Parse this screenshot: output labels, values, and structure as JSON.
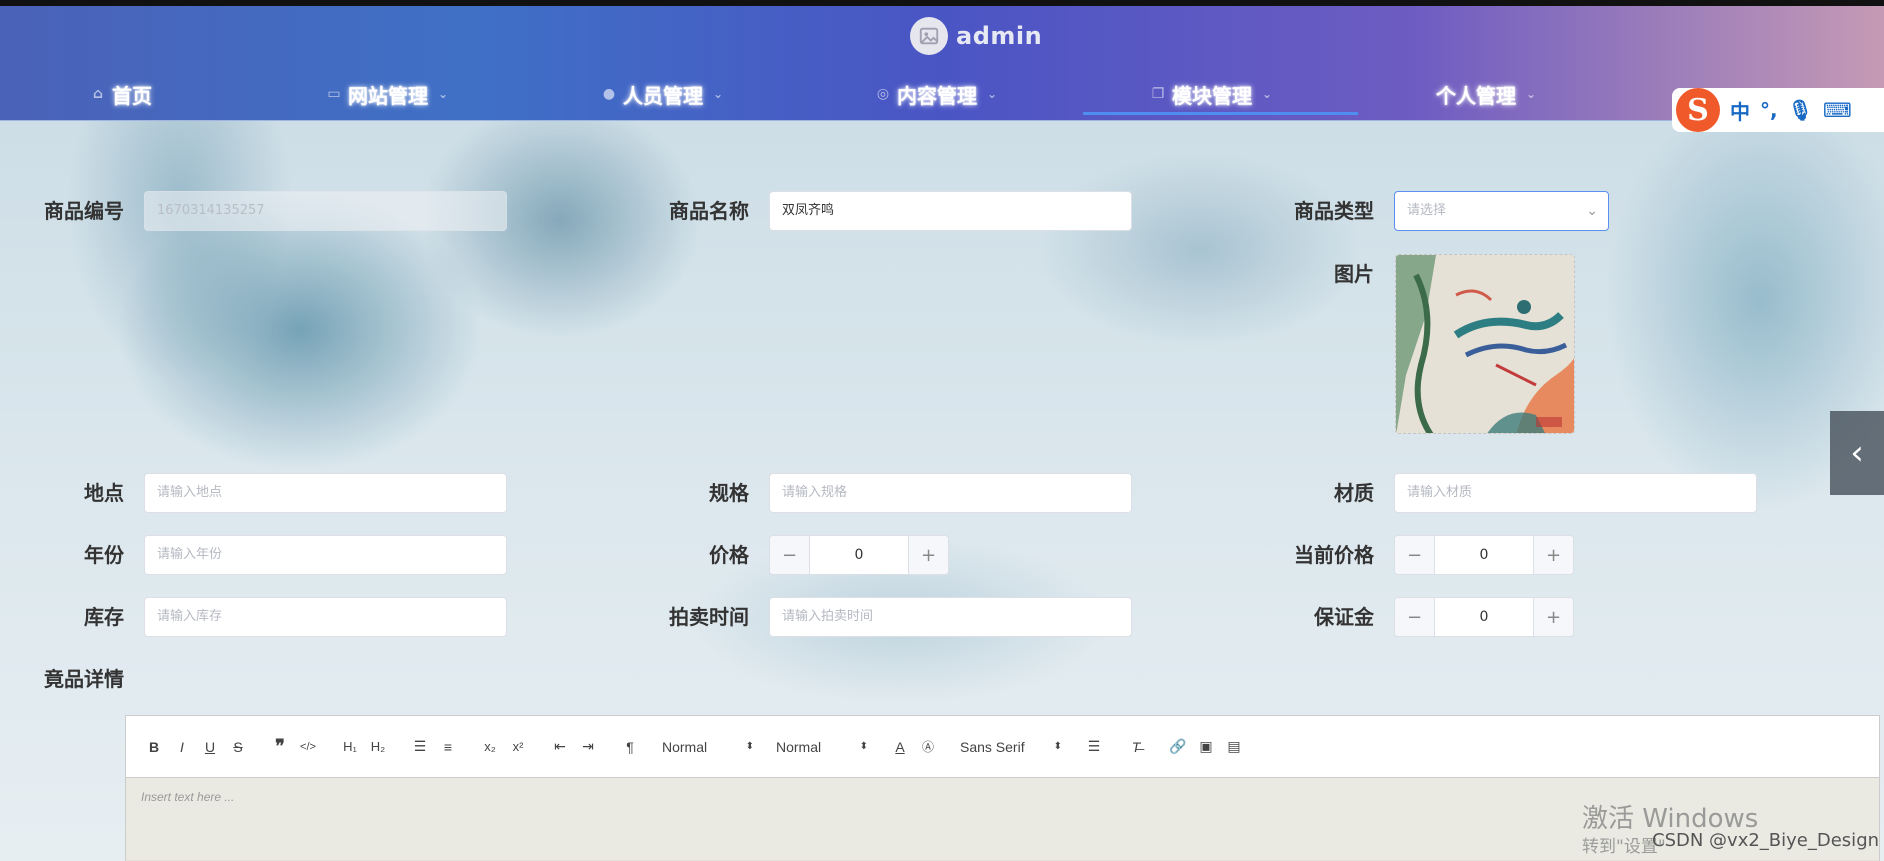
{
  "header": {
    "username": "admin",
    "nav": [
      {
        "label": "首页",
        "icon": "home-icon"
      },
      {
        "label": "网站管理",
        "icon": "monitor-icon"
      },
      {
        "label": "人员管理",
        "icon": "user-icon"
      },
      {
        "label": "内容管理",
        "icon": "content-icon"
      },
      {
        "label": "模块管理",
        "icon": "module-icon"
      },
      {
        "label": "个人管理",
        "icon": ""
      }
    ],
    "active_nav": "模块管理"
  },
  "ime": {
    "mode": "中",
    "punct": "°,"
  },
  "form": {
    "product_id": {
      "label": "商品编号",
      "value": "1670314135257"
    },
    "product_name": {
      "label": "商品名称",
      "value": "双凤齐鸣"
    },
    "product_type": {
      "label": "商品类型",
      "placeholder": "请选择"
    },
    "image": {
      "label": "图片"
    },
    "location": {
      "label": "地点",
      "placeholder": "请输入地点"
    },
    "spec": {
      "label": "规格",
      "placeholder": "请输入规格"
    },
    "material": {
      "label": "材质",
      "placeholder": "请输入材质"
    },
    "year": {
      "label": "年份",
      "placeholder": "请输入年份"
    },
    "price": {
      "label": "价格",
      "value": "0"
    },
    "current_price": {
      "label": "当前价格",
      "value": "0"
    },
    "stock": {
      "label": "库存",
      "placeholder": "请输入库存"
    },
    "auction_time": {
      "label": "拍卖时间",
      "placeholder": "请输入拍卖时间"
    },
    "deposit": {
      "label": "保证金",
      "value": "0"
    },
    "details": {
      "label": "竟品详情"
    }
  },
  "editor": {
    "header_select": "Normal",
    "size_select": "Normal",
    "font_select": "Sans Serif",
    "placeholder": "Insert text here ..."
  },
  "watermarks": {
    "activate": "激活 Windows",
    "goto": "转到\"设置\"",
    "csdn": "CSDN @vx2_Biye_Design"
  },
  "colors": {
    "accent": "#4f8df0",
    "header_start": "#4a62b8",
    "header_end": "#c59ab4"
  }
}
